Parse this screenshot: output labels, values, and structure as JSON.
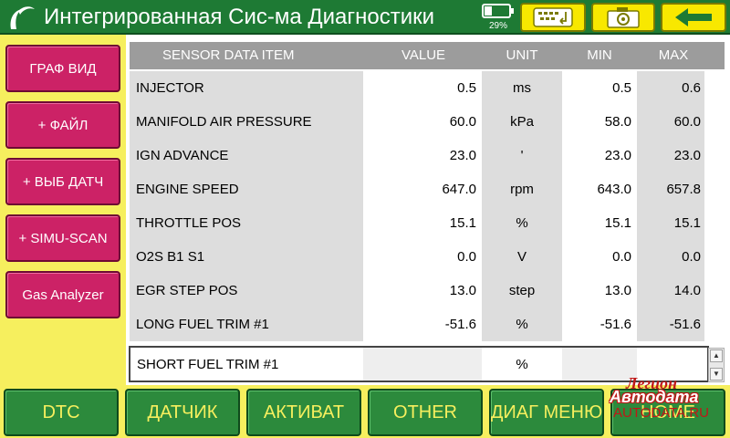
{
  "header": {
    "title": "Интегрированная Сис-ма Диагностики",
    "battery_level": "29%",
    "battery_fraction": 0.29,
    "icons": {
      "keyboard": "keyboard-icon",
      "camera": "camera-icon",
      "back": "back-arrow-icon"
    }
  },
  "side_menu": {
    "graph_view": "ГРАФ ВИД",
    "file": "+ ФАЙЛ",
    "select_sensor": "+ ВЫБ ДАТЧ",
    "simu_scan": "+ SIMU-SCAN",
    "gas_analyzer": "Gas Analyzer"
  },
  "table": {
    "headers": {
      "item": "SENSOR DATA ITEM",
      "value": "VALUE",
      "unit": "UNIT",
      "min": "MIN",
      "max": "MAX"
    },
    "rows": [
      {
        "item": "INJECTOR",
        "value": "0.5",
        "unit": "ms",
        "min": "0.5",
        "max": "0.6"
      },
      {
        "item": "MANIFOLD AIR PRESSURE",
        "value": "60.0",
        "unit": "kPa",
        "min": "58.0",
        "max": "60.0"
      },
      {
        "item": "IGN ADVANCE",
        "value": "23.0",
        "unit": "'",
        "min": "23.0",
        "max": "23.0"
      },
      {
        "item": "ENGINE SPEED",
        "value": "647.0",
        "unit": "rpm",
        "min": "643.0",
        "max": "657.8"
      },
      {
        "item": "THROTTLE POS",
        "value": "15.1",
        "unit": "%",
        "min": "15.1",
        "max": "15.1"
      },
      {
        "item": "O2S B1 S1",
        "value": "0.0",
        "unit": "V",
        "min": "0.0",
        "max": "0.0"
      },
      {
        "item": "EGR STEP POS",
        "value": "13.0",
        "unit": "step",
        "min": "13.0",
        "max": "14.0"
      },
      {
        "item": "LONG FUEL TRIM #1",
        "value": "-51.6",
        "unit": "%",
        "min": "-51.6",
        "max": "-51.6"
      }
    ],
    "selected_row": {
      "item": "SHORT FUEL TRIM #1",
      "unit": "%"
    }
  },
  "bottom_nav": {
    "dtc": "DTC",
    "sensor": "ДАТЧИК",
    "activate": "АКТИВАТ",
    "other": "OTHER",
    "diag_menu": "ДИАГ МЕНЮ",
    "home": "HOME"
  },
  "watermark": {
    "line1": "Легион",
    "line2": "Автодата",
    "line3": "AUTODATA.RU"
  },
  "colors": {
    "background": "#f6ef5e",
    "header": "#1e7a34",
    "side_button": "#cc2266",
    "nav_button": "#2c8a3c",
    "nav_text": "#f6ef5e",
    "table_header": "#9c9c9c",
    "watermark": "#c01818"
  }
}
